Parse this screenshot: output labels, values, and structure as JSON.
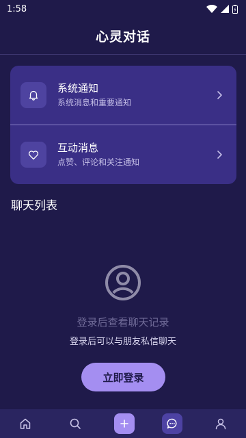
{
  "status_bar": {
    "time": "1:58"
  },
  "header": {
    "title": "心灵对话"
  },
  "notifications": {
    "items": [
      {
        "title": "系统通知",
        "subtitle": "系统消息和重要通知"
      },
      {
        "title": "互动消息",
        "subtitle": "点赞、评论和关注通知"
      }
    ]
  },
  "chat_list": {
    "title": "聊天列表"
  },
  "empty_state": {
    "message": "登录后查看聊天记录",
    "hint": "登录后可以与朋友私信聊天",
    "button_label": "立即登录"
  },
  "colors": {
    "background": "#1f1a4a",
    "card": "#3a2f86",
    "accent": "#a48ef1",
    "nav": "#2a2560"
  },
  "icons": [
    "wifi-icon",
    "signal-icon",
    "battery-icon",
    "bell-icon",
    "heart-icon",
    "chevron-right-icon",
    "user-circle-icon",
    "home-icon",
    "search-icon",
    "plus-icon",
    "chat-icon",
    "profile-icon"
  ]
}
